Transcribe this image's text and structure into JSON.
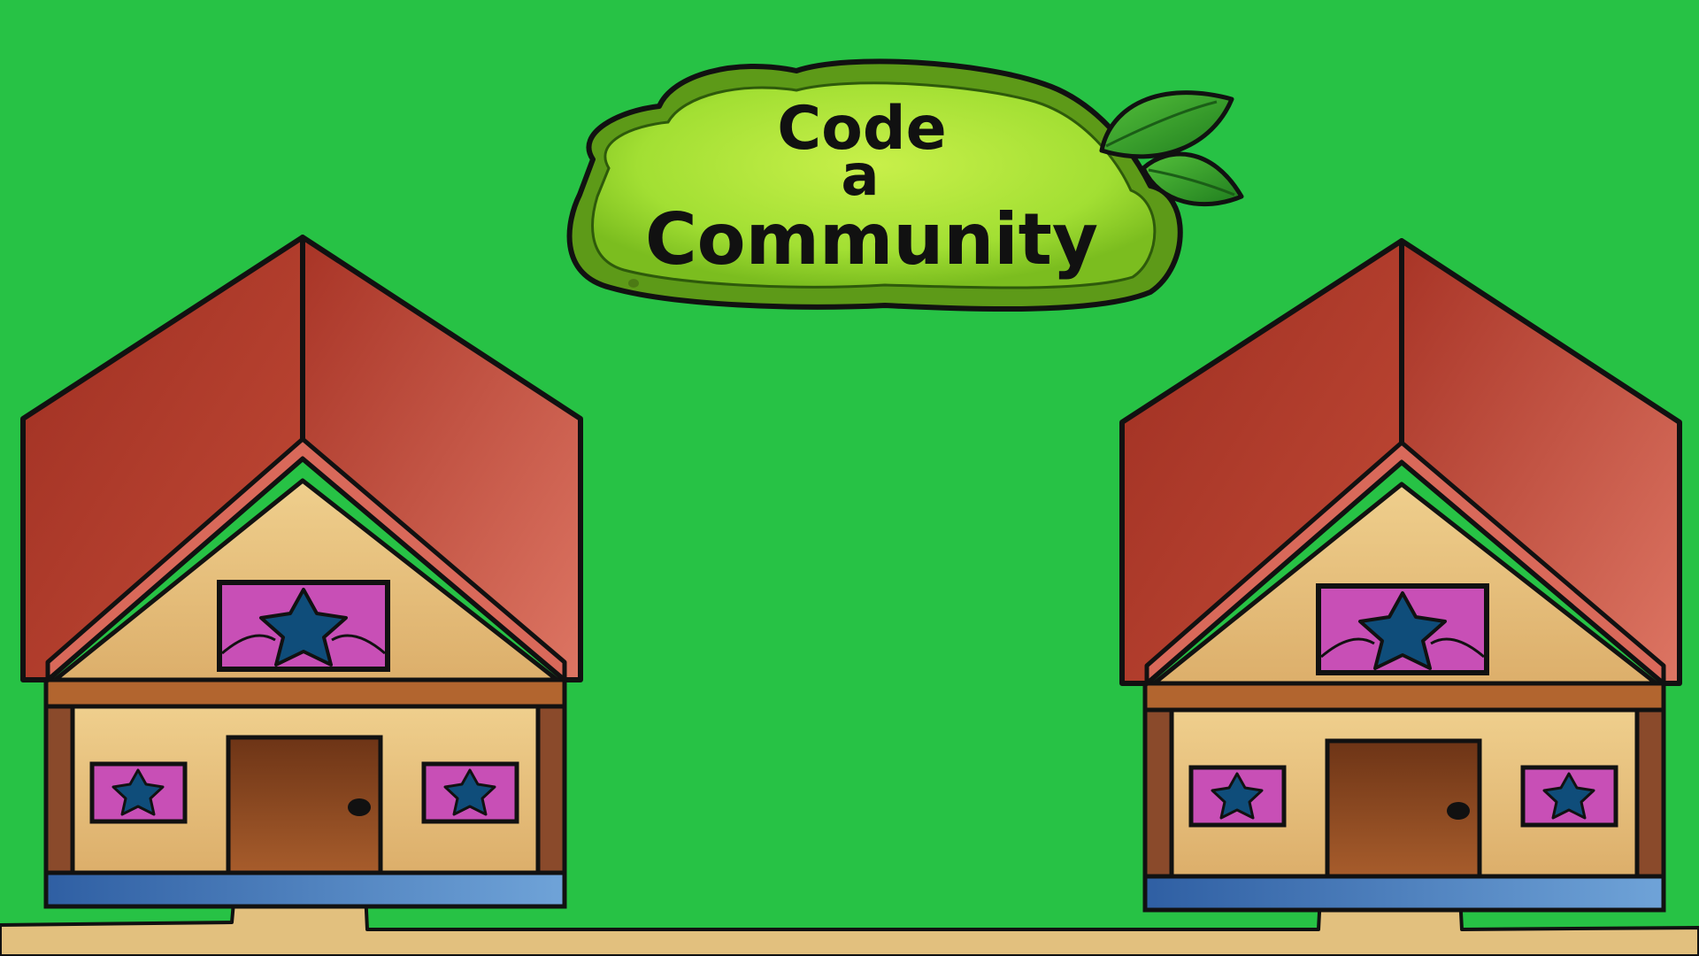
{
  "title": {
    "line1": "Code",
    "line2": "a",
    "line3": "Community"
  },
  "colors": {
    "grass": "#27c245",
    "path": "#e2c07e",
    "roof": "#b33d2c",
    "roof_edge": "#d9695a",
    "wall": "#e6bd7b",
    "trim": "#8a4a2b",
    "door": "#8b4a20",
    "window_curtain": "#c84fb6",
    "window_star": "#0f4d7a",
    "porch": "#3f77b8",
    "sign": "#a9e23a",
    "sign_border": "#5d9a18",
    "leaf": "#2e9e2a"
  },
  "houses": [
    {
      "name": "left-house"
    },
    {
      "name": "right-house"
    }
  ]
}
